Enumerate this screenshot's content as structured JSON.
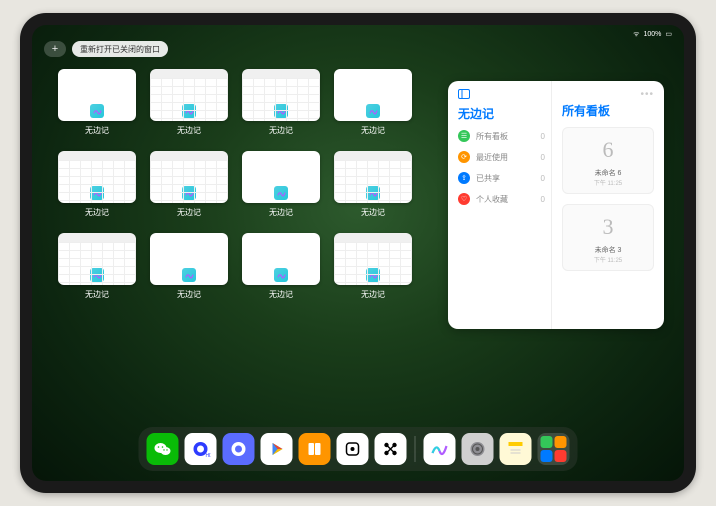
{
  "statusbar": {
    "wifi": "⋮⋮",
    "battery_text": "100%"
  },
  "topbar": {
    "plus_label": "+",
    "reopen_label": "重新打开已关闭的窗口"
  },
  "app_label": "无边记",
  "windows": [
    {
      "style": "blank"
    },
    {
      "style": "grid"
    },
    {
      "style": "grid"
    },
    {
      "style": "blank"
    },
    {
      "style": "grid"
    },
    {
      "style": "grid"
    },
    {
      "style": "blank"
    },
    {
      "style": "grid"
    },
    {
      "style": "grid"
    },
    {
      "style": "blank"
    },
    {
      "style": "blank"
    },
    {
      "style": "grid"
    }
  ],
  "panel": {
    "left": {
      "title": "无边记",
      "items": [
        {
          "icon_color": "#34c759",
          "glyph": "☰",
          "label": "所有看板",
          "count": 0
        },
        {
          "icon_color": "#ff9500",
          "glyph": "⟳",
          "label": "最近使用",
          "count": 0
        },
        {
          "icon_color": "#007aff",
          "glyph": "⇪",
          "label": "已共享",
          "count": 0
        },
        {
          "icon_color": "#ff3b30",
          "glyph": "♡",
          "label": "个人收藏",
          "count": 0
        }
      ]
    },
    "right": {
      "title": "所有看板",
      "boards": [
        {
          "sketch": "6",
          "name": "未命名 6",
          "time": "下午 11:25"
        },
        {
          "sketch": "3",
          "name": "未命名 3",
          "time": "下午 11:25"
        }
      ]
    }
  },
  "dock": {
    "main": [
      {
        "name": "wechat",
        "bg": "#09bb07"
      },
      {
        "name": "quark-hd",
        "bg": "#ffffff"
      },
      {
        "name": "quark",
        "bg": "#5b6cff"
      },
      {
        "name": "play",
        "bg": "#ffffff"
      },
      {
        "name": "books",
        "bg": "#ff9500"
      },
      {
        "name": "dice",
        "bg": "#ffffff"
      },
      {
        "name": "graph",
        "bg": "#ffffff"
      }
    ],
    "recent": [
      {
        "name": "freeform",
        "bg": "#ffffff"
      },
      {
        "name": "settings",
        "bg": "#d0d0d0"
      },
      {
        "name": "notes",
        "bg": "#fff9d6"
      }
    ]
  }
}
